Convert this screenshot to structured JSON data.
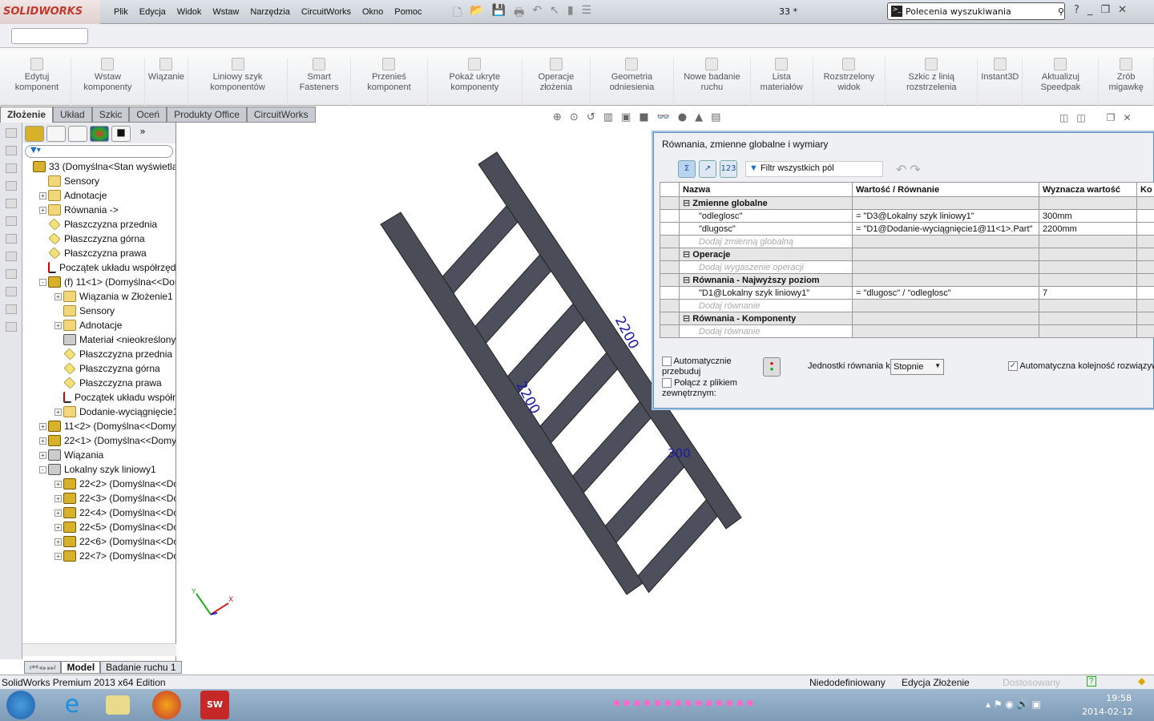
{
  "app": {
    "logo": "SOLIDWORKS",
    "doc_title": "33 *",
    "search_placeholder": "Polecenia wyszukiwania"
  },
  "menu": [
    "Plik",
    "Edycja",
    "Widok",
    "Wstaw",
    "Narzędzia",
    "CircuitWorks",
    "Okno",
    "Pomoc"
  ],
  "ribbon": [
    {
      "label": "Edytuj komponent"
    },
    {
      "label": "Wstaw komponenty"
    },
    {
      "label": "Wiązanie"
    },
    {
      "label": "Liniowy szyk komponentów"
    },
    {
      "label": "Smart Fasteners"
    },
    {
      "label": "Przenieś komponent"
    },
    {
      "label": "Pokaż ukryte komponenty"
    },
    {
      "label": "Operacje złożenia"
    },
    {
      "label": "Geometria odniesienia"
    },
    {
      "label": "Nowe badanie ruchu"
    },
    {
      "label": "Lista materiałów"
    },
    {
      "label": "Rozstrzelony widok"
    },
    {
      "label": "Szkic z linią rozstrzelenia"
    },
    {
      "label": "Instant3D"
    },
    {
      "label": "Aktualizuj Speedpak"
    },
    {
      "label": "Zrób migawkę"
    }
  ],
  "tabs": [
    "Złożenie",
    "Układ",
    "Szkic",
    "Oceń",
    "Produkty Office",
    "CircuitWorks"
  ],
  "tree": [
    {
      "label": "33  (Domyślna<Stan wyświetlan",
      "icon": "asm",
      "lvl": 0,
      "exp": ""
    },
    {
      "label": "Sensory",
      "icon": "fold",
      "lvl": 1,
      "exp": ""
    },
    {
      "label": "Adnotacje",
      "icon": "fold",
      "lvl": 1,
      "exp": "+"
    },
    {
      "label": "Równania ->",
      "icon": "fold",
      "lvl": 1,
      "exp": "+"
    },
    {
      "label": "Płaszczyzna przednia",
      "icon": "plane",
      "lvl": 1,
      "exp": ""
    },
    {
      "label": "Płaszczyzna górna",
      "icon": "plane",
      "lvl": 1,
      "exp": ""
    },
    {
      "label": "Płaszczyzna prawa",
      "icon": "plane",
      "lvl": 1,
      "exp": ""
    },
    {
      "label": "Początek układu współrzędn",
      "icon": "orig",
      "lvl": 1,
      "exp": ""
    },
    {
      "label": "(f) 11<1>  (Domyślna<<Dom",
      "icon": "asm",
      "lvl": 1,
      "exp": "-"
    },
    {
      "label": "Wiązania w Złożenie1",
      "icon": "fold",
      "lvl": 2,
      "exp": "+"
    },
    {
      "label": "Sensory",
      "icon": "fold",
      "lvl": 2,
      "exp": ""
    },
    {
      "label": "Adnotacje",
      "icon": "fold",
      "lvl": 2,
      "exp": "+"
    },
    {
      "label": "Materiał <nieokreślony>",
      "icon": "mate",
      "lvl": 2,
      "exp": ""
    },
    {
      "label": "Płaszczyzna przednia",
      "icon": "plane",
      "lvl": 2,
      "exp": ""
    },
    {
      "label": "Płaszczyzna górna",
      "icon": "plane",
      "lvl": 2,
      "exp": ""
    },
    {
      "label": "Płaszczyzna prawa",
      "icon": "plane",
      "lvl": 2,
      "exp": ""
    },
    {
      "label": "Początek układu współrz",
      "icon": "orig",
      "lvl": 2,
      "exp": ""
    },
    {
      "label": "Dodanie-wyciągnięcie1",
      "icon": "fold",
      "lvl": 2,
      "exp": "+"
    },
    {
      "label": "11<2>  (Domyślna<<Domyś",
      "icon": "asm",
      "lvl": 1,
      "exp": "+"
    },
    {
      "label": "22<1>  (Domyślna<<Domyś",
      "icon": "asm",
      "lvl": 1,
      "exp": "+"
    },
    {
      "label": "Wiązania",
      "icon": "mate",
      "lvl": 1,
      "exp": "+"
    },
    {
      "label": "Lokalny szyk liniowy1",
      "icon": "mate",
      "lvl": 1,
      "exp": "-"
    },
    {
      "label": "22<2>  (Domyślna<<Dor",
      "icon": "asm",
      "lvl": 2,
      "exp": "+"
    },
    {
      "label": "22<3>  (Domyślna<<Dor",
      "icon": "asm",
      "lvl": 2,
      "exp": "+"
    },
    {
      "label": "22<4>  (Domyślna<<Dor",
      "icon": "asm",
      "lvl": 2,
      "exp": "+"
    },
    {
      "label": "22<5>  (Domyślna<<Dor",
      "icon": "asm",
      "lvl": 2,
      "exp": "+"
    },
    {
      "label": "22<6>  (Domyślna<<Dor",
      "icon": "asm",
      "lvl": 2,
      "exp": "+"
    },
    {
      "label": "22<7>  (Domyślna<<Dor",
      "icon": "asm",
      "lvl": 2,
      "exp": "+"
    }
  ],
  "viewport": {
    "dims": [
      "2200",
      "2200",
      "300"
    ],
    "axes": {
      "x": "X",
      "y": "Y"
    }
  },
  "dialog": {
    "title": "Równania, zmienne globalne i wymiary",
    "filter": "Filtr wszystkich pól",
    "headers": [
      "Nazwa",
      "Wartość / Równanie",
      "Wyznacza wartość",
      "Ko"
    ],
    "rows": [
      {
        "type": "grp",
        "name": "Zmienne globalne"
      },
      {
        "type": "row",
        "name": "\"odleglosc\"",
        "eq": "= \"D3@Lokalny szyk liniowy1\"",
        "val": "300mm"
      },
      {
        "type": "row",
        "name": "\"dlugosc\"",
        "eq": "= \"D1@Dodanie-wyciągnięcie1@11<1>.Part\"",
        "val": "2200mm"
      },
      {
        "type": "add",
        "name": "Dodaj zmienną globalną"
      },
      {
        "type": "grp",
        "name": "Operacje"
      },
      {
        "type": "add",
        "name": "Dodaj wygaszenie operacji"
      },
      {
        "type": "grp",
        "name": "Równania - Najwyższy poziom"
      },
      {
        "type": "row",
        "name": "\"D1@Lokalny szyk liniowy1\"",
        "eq": "= \"dlugosc\" / \"odleglosc\"",
        "val": "7"
      },
      {
        "type": "add",
        "name": "Dodaj równanie"
      },
      {
        "type": "grp",
        "name": "Równania - Komponenty"
      },
      {
        "type": "add",
        "name": "Dodaj równanie"
      }
    ],
    "auto_rebuild": "Automatycznie przebuduj",
    "auto_rebuild_checked": false,
    "link_file": "Połącz z plikiem zewnętrznym:",
    "link_file_checked": false,
    "units_label": "Jednostki równania k",
    "units_value": "Stopnie",
    "auto_order": "Automatyczna kolejność rozwiązyw",
    "auto_order_checked": true
  },
  "bottom_tabs": [
    "Model",
    "Badanie ruchu 1"
  ],
  "status": {
    "edition": "SolidWorks Premium 2013 x64 Edition",
    "state": "Niedodefiniowany",
    "mode": "Edycja Złożenie",
    "custom": "Dostosowany"
  },
  "taskbar": {
    "time": "19:58",
    "date": "2014-02-12"
  }
}
